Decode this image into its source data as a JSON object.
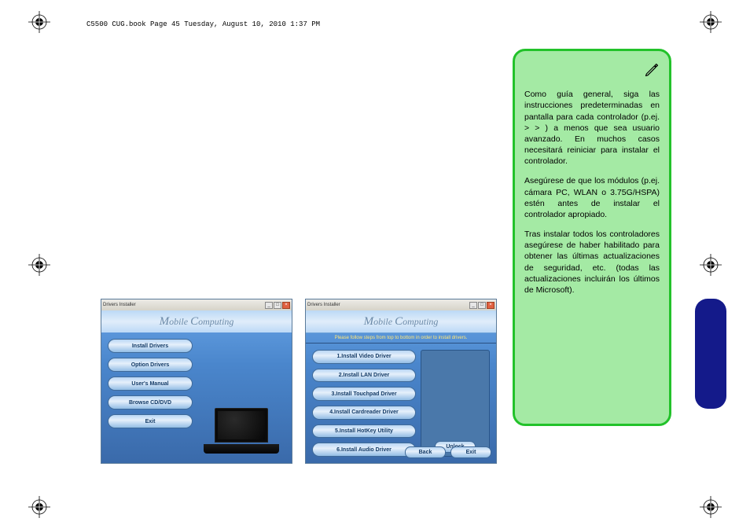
{
  "header": "C5500 CUG.book  Page 45  Tuesday, August 10, 2010  1:37 PM",
  "screenshot1": {
    "title": "Drivers Installer",
    "brand": "Mobile Computing",
    "buttons": [
      "Install Drivers",
      "Option Drivers",
      "User's Manual",
      "Browse CD/DVD",
      "Exit"
    ]
  },
  "screenshot2": {
    "title": "Drivers Installer",
    "brand": "Mobile Computing",
    "instruction": "Please follow steps from top to bottom in order to install drivers.",
    "buttons": [
      "1.Install Video Driver",
      "2.Install LAN Driver",
      "3.Install Touchpad Driver",
      "4.Install Cardreader Driver",
      "5.Install HotKey Utility",
      "6.Install Audio Driver"
    ],
    "unlock": "Unlock",
    "back": "Back",
    "exit": "Exit"
  },
  "note": {
    "p1": "Como guía general, siga las instrucciones predeterminadas en pantalla para cada controlador (p.ej.               >        >             ) a menos que sea usuario avanzado. En muchos casos necesitará reiniciar para instalar el controlador.",
    "p2": "Asegúrese de que los módulos (p.ej. cámara PC, WLAN o 3.75G/HSPA) estén               antes de instalar el controlador apropiado.",
    "p3": "Tras instalar todos los controladores asegúrese de haber habilitado                         para obtener las últimas actualizaciones de seguridad, etc. (todas las actualizaciones incluirán los últimos          de Microsoft)."
  }
}
